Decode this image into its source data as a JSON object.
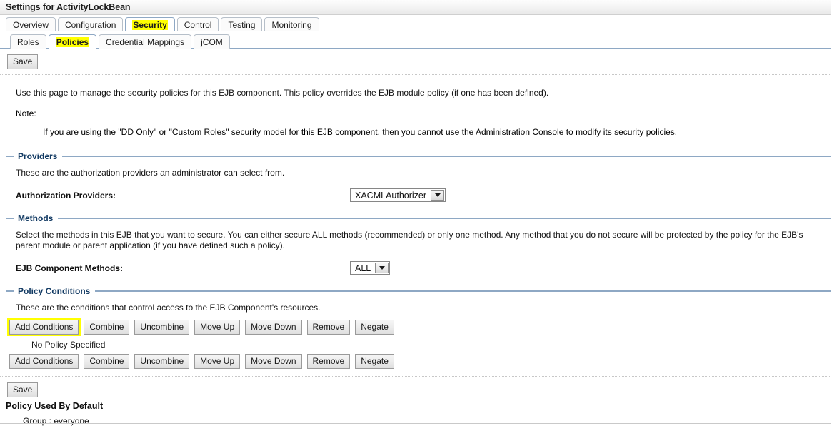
{
  "window": {
    "title": "Settings for ActivityLockBean"
  },
  "tabs": {
    "primary": [
      {
        "label": "Overview",
        "active": false
      },
      {
        "label": "Configuration",
        "active": false
      },
      {
        "label": "Security",
        "active": true
      },
      {
        "label": "Control",
        "active": false
      },
      {
        "label": "Testing",
        "active": false
      },
      {
        "label": "Monitoring",
        "active": false
      }
    ],
    "secondary": [
      {
        "label": "Roles",
        "active": false
      },
      {
        "label": "Policies",
        "active": true
      },
      {
        "label": "Credential Mappings",
        "active": false
      },
      {
        "label": "jCOM",
        "active": false
      }
    ]
  },
  "toolbar": {
    "save_label": "Save"
  },
  "intro": {
    "paragraph": "Use this page to manage the security policies for this EJB component. This policy overrides the EJB module policy (if one has been defined).",
    "note_label": "Note:",
    "note_body": "If you are using the \"DD Only\" or \"Custom Roles\" security model for this EJB component, then you cannot use the Administration Console to modify its security policies."
  },
  "providers": {
    "title": "Providers",
    "description": "These are the authorization providers an administrator can select from.",
    "field_label": "Authorization Providers:",
    "selected": "XACMLAuthorizer"
  },
  "methods": {
    "title": "Methods",
    "description": "Select the methods in this EJB that you want to secure. You can either secure ALL methods (recommended) or only one method. Any method that you do not secure will be protected by the policy for the EJB's parent module or parent application (if you have defined such a policy).",
    "field_label": "EJB Component Methods:",
    "selected": "ALL"
  },
  "policy_conditions": {
    "title": "Policy Conditions",
    "description": "These are the conditions that control access to the EJB Component's resources.",
    "buttons": [
      "Add Conditions",
      "Combine",
      "Uncombine",
      "Move Up",
      "Move Down",
      "Remove",
      "Negate"
    ],
    "status_text": "No Policy Specified",
    "highlight_color": "#ffff00"
  },
  "footer": {
    "save_label": "Save",
    "policy_default_title": "Policy Used By Default",
    "policy_default_entry": "Group : everyone"
  }
}
